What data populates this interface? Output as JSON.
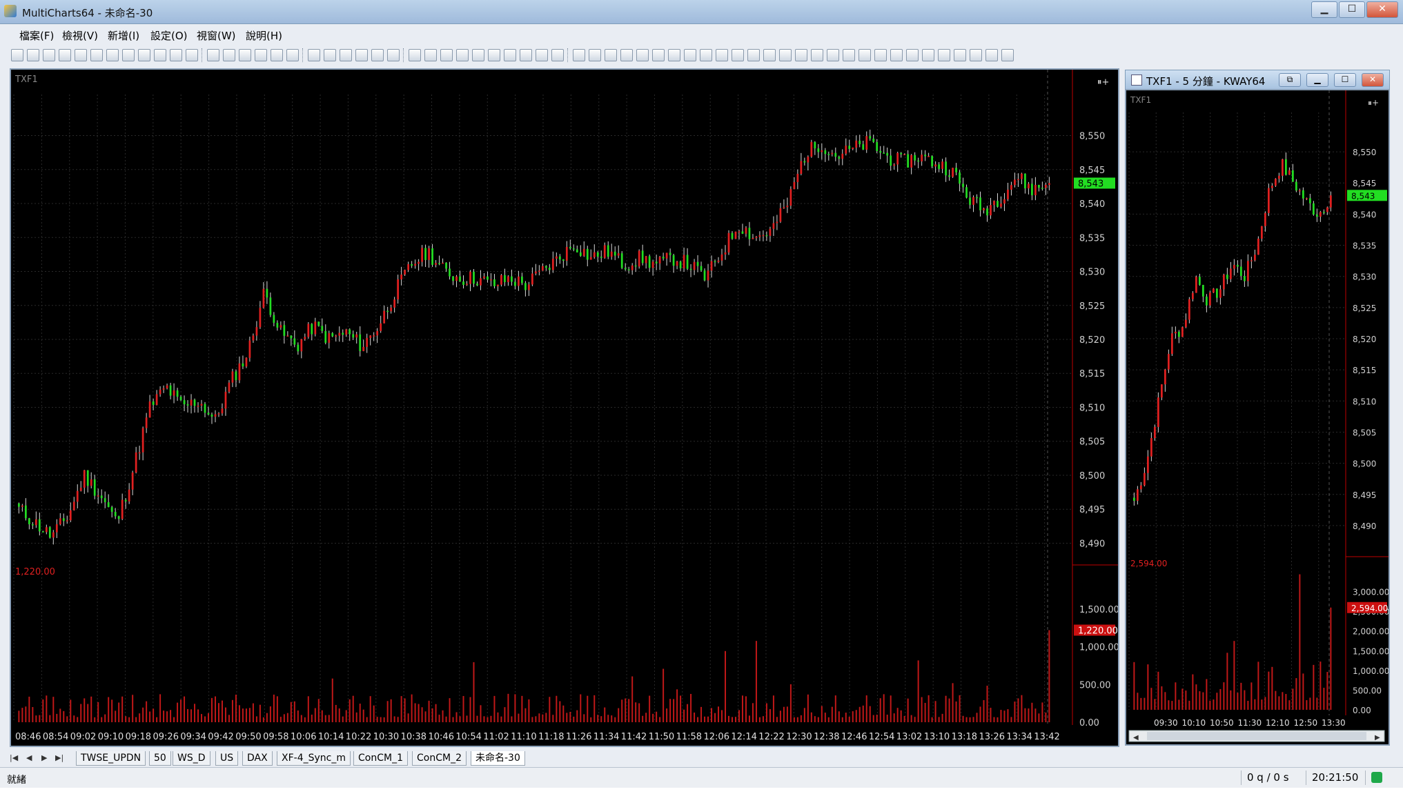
{
  "window": {
    "title": "MultiCharts64 - 未命名-30",
    "min_label": "▁",
    "max_label": "☐",
    "close_label": "✕"
  },
  "menu": [
    "檔案(F)",
    "檢視(V)",
    "新增(I)",
    "設定(O)",
    "視窗(W)",
    "說明(H)"
  ],
  "main_chart": {
    "symbol": "TXF1",
    "price_ticks": [
      "8,550",
      "8,545",
      "8,540",
      "8,535",
      "8,530",
      "8,525",
      "8,520",
      "8,515",
      "8,510",
      "8,505",
      "8,500",
      "8,495",
      "8,490"
    ],
    "last_price": "8,543",
    "volume_label": "1,220.00",
    "volume_ticks": [
      "1,500.00",
      "1,000.00",
      "500.00",
      "0.00"
    ],
    "time_ticks": [
      "08:46",
      "08:54",
      "09:02",
      "09:10",
      "09:18",
      "09:26",
      "09:34",
      "09:42",
      "09:50",
      "09:58",
      "10:06",
      "10:14",
      "10:22",
      "10:30",
      "10:38",
      "10:46",
      "10:54",
      "11:02",
      "11:10",
      "11:18",
      "11:26",
      "11:34",
      "11:42",
      "11:50",
      "11:58",
      "12:06",
      "12:14",
      "12:22",
      "12:30",
      "12:38",
      "12:46",
      "12:54",
      "13:02",
      "13:10",
      "13:18",
      "13:26",
      "13:34",
      "13:42"
    ]
  },
  "side_chart": {
    "window_title": "TXF1 - 5 分鐘 - KWAY64",
    "symbol": "TXF1",
    "price_ticks": [
      "8,550",
      "8,545",
      "8,540",
      "8,535",
      "8,530",
      "8,525",
      "8,520",
      "8,515",
      "8,510",
      "8,505",
      "8,500",
      "8,495",
      "8,490"
    ],
    "last_price": "8,543",
    "volume_label": "2,594.00",
    "volume_ticks": [
      "3,000.00",
      "2,500.00",
      "2,000.00",
      "1,500.00",
      "1,000.00",
      "500.00",
      "0.00"
    ],
    "time_ticks": [
      "09:30",
      "10:10",
      "10:50",
      "11:30",
      "12:10",
      "12:50",
      "13:30"
    ]
  },
  "chart_data": [
    {
      "type": "candlestick",
      "title": "TXF1",
      "timeframe": "1 minute",
      "x_range": [
        "08:46",
        "13:45"
      ],
      "y_range": [
        8487,
        8553
      ],
      "approx_close_path": [
        8495,
        8493,
        8491,
        8494,
        8500,
        8497,
        8493,
        8501,
        8510,
        8513,
        8510,
        8511,
        8508,
        8514,
        8518,
        8527,
        8521,
        8519,
        8522,
        8520,
        8521,
        8519,
        8522,
        8527,
        8531,
        8533,
        8530,
        8529,
        8529,
        8528,
        8529,
        8528,
        8530,
        8532,
        8534,
        8532,
        8533,
        8531,
        8532,
        8531,
        8532,
        8531,
        8529,
        8533,
        8537,
        8535,
        8536,
        8540,
        8547,
        8549,
        8547,
        8548,
        8549,
        8547,
        8546,
        8547,
        8546,
        8545,
        8541,
        8539,
        8541,
        8544,
        8542,
        8543
      ],
      "last_price": 8543,
      "volume_last": 1220,
      "volume_axis": [
        0,
        1500
      ]
    },
    {
      "type": "candlestick",
      "title": "TXF1 - 5 分鐘",
      "timeframe": "5 minute",
      "y_range": [
        8487,
        8553
      ],
      "approx_close_path": [
        8494,
        8500,
        8510,
        8520,
        8522,
        8530,
        8526,
        8528,
        8532,
        8530,
        8535,
        8544,
        8548,
        8545,
        8542,
        8540,
        8543
      ],
      "last_price": 8543,
      "volume_last": 2594,
      "volume_axis": [
        0,
        3000
      ]
    }
  ],
  "tabs": [
    "TWSE_UPDN",
    "50",
    "WS_D",
    "US",
    "DAX",
    "XF-4_Sync_m",
    "ConCM_1",
    "ConCM_2",
    "未命名-30"
  ],
  "status": {
    "ready": "就緒",
    "queue": "0 q / 0 s",
    "clock": "20:21:50"
  },
  "colors": {
    "up": "#e02020",
    "down": "#22dd22",
    "background": "#000000",
    "axis_red": "#c00000",
    "last_marker": "#22dd22"
  },
  "icons": [
    "new-icon",
    "open-icon",
    "save-icon",
    "print-icon",
    "zoom-in-icon",
    "zoom-out-icon",
    "hand-icon",
    "cursor-icon",
    "bar-icon",
    "candle-icon"
  ]
}
